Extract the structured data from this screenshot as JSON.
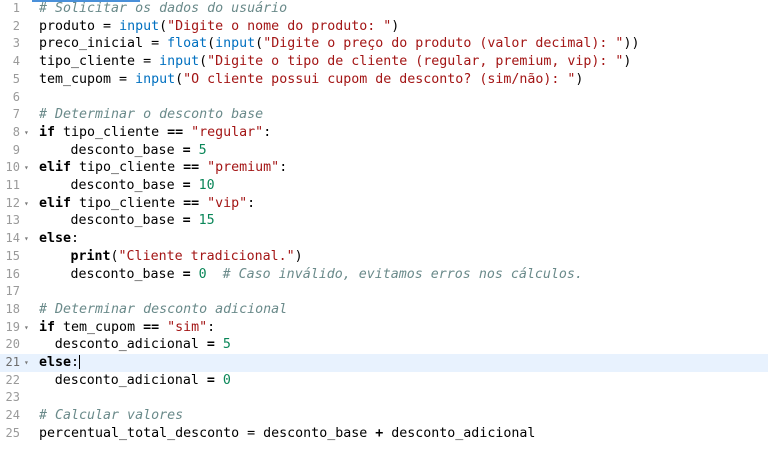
{
  "editor": {
    "active_line": 21,
    "lines": [
      {
        "n": "1",
        "fold": "",
        "indent": 0,
        "tokens": [
          {
            "t": "comment",
            "v": "# Solicitar os dados do usuário"
          }
        ]
      },
      {
        "n": "2",
        "fold": "",
        "indent": 0,
        "tokens": [
          {
            "t": "plain",
            "v": "produto = "
          },
          {
            "t": "fn",
            "v": "input"
          },
          {
            "t": "plain",
            "v": "("
          },
          {
            "t": "str",
            "v": "\"Digite o nome do produto: \""
          },
          {
            "t": "plain",
            "v": ")"
          }
        ]
      },
      {
        "n": "3",
        "fold": "",
        "indent": 0,
        "tokens": [
          {
            "t": "plain",
            "v": "preco_inicial = "
          },
          {
            "t": "fn",
            "v": "float"
          },
          {
            "t": "plain",
            "v": "("
          },
          {
            "t": "fn",
            "v": "input"
          },
          {
            "t": "plain",
            "v": "("
          },
          {
            "t": "str",
            "v": "\"Digite o preço do produto (valor decimal): \""
          },
          {
            "t": "plain",
            "v": "))"
          }
        ]
      },
      {
        "n": "4",
        "fold": "",
        "indent": 0,
        "tokens": [
          {
            "t": "plain",
            "v": "tipo_cliente = "
          },
          {
            "t": "fn",
            "v": "input"
          },
          {
            "t": "plain",
            "v": "("
          },
          {
            "t": "str",
            "v": "\"Digite o tipo de cliente (regular, premium, vip): \""
          },
          {
            "t": "plain",
            "v": ")"
          }
        ]
      },
      {
        "n": "5",
        "fold": "",
        "indent": 0,
        "tokens": [
          {
            "t": "plain",
            "v": "tem_cupom = "
          },
          {
            "t": "fn",
            "v": "input"
          },
          {
            "t": "plain",
            "v": "("
          },
          {
            "t": "str",
            "v": "\"O cliente possui cupom de desconto? (sim/não): \""
          },
          {
            "t": "plain",
            "v": ")"
          }
        ]
      },
      {
        "n": "6",
        "fold": "",
        "indent": 0,
        "tokens": []
      },
      {
        "n": "7",
        "fold": "",
        "indent": 0,
        "tokens": [
          {
            "t": "comment",
            "v": "# Determinar o desconto base"
          }
        ]
      },
      {
        "n": "8",
        "fold": "▾",
        "indent": 0,
        "tokens": [
          {
            "t": "kw",
            "v": "if"
          },
          {
            "t": "plain",
            "v": " tipo_cliente "
          },
          {
            "t": "kw",
            "v": "=="
          },
          {
            "t": "plain",
            "v": " "
          },
          {
            "t": "str",
            "v": "\"regular\""
          },
          {
            "t": "plain",
            "v": ":"
          }
        ]
      },
      {
        "n": "9",
        "fold": "",
        "indent": 1,
        "tokens": [
          {
            "t": "plain",
            "v": "desconto_base "
          },
          {
            "t": "kw",
            "v": "="
          },
          {
            "t": "plain",
            "v": " "
          },
          {
            "t": "num",
            "v": "5"
          }
        ]
      },
      {
        "n": "10",
        "fold": "▾",
        "indent": 0,
        "tokens": [
          {
            "t": "kw",
            "v": "elif"
          },
          {
            "t": "plain",
            "v": " tipo_cliente "
          },
          {
            "t": "kw",
            "v": "=="
          },
          {
            "t": "plain",
            "v": " "
          },
          {
            "t": "str",
            "v": "\"premium\""
          },
          {
            "t": "plain",
            "v": ":"
          }
        ]
      },
      {
        "n": "11",
        "fold": "",
        "indent": 1,
        "tokens": [
          {
            "t": "plain",
            "v": "desconto_base "
          },
          {
            "t": "kw",
            "v": "="
          },
          {
            "t": "plain",
            "v": " "
          },
          {
            "t": "num",
            "v": "10"
          }
        ]
      },
      {
        "n": "12",
        "fold": "▾",
        "indent": 0,
        "tokens": [
          {
            "t": "kw",
            "v": "elif"
          },
          {
            "t": "plain",
            "v": " tipo_cliente "
          },
          {
            "t": "kw",
            "v": "=="
          },
          {
            "t": "plain",
            "v": " "
          },
          {
            "t": "str",
            "v": "\"vip\""
          },
          {
            "t": "plain",
            "v": ":"
          }
        ]
      },
      {
        "n": "13",
        "fold": "",
        "indent": 1,
        "tokens": [
          {
            "t": "plain",
            "v": "desconto_base "
          },
          {
            "t": "kw",
            "v": "="
          },
          {
            "t": "plain",
            "v": " "
          },
          {
            "t": "num",
            "v": "15"
          }
        ]
      },
      {
        "n": "14",
        "fold": "▾",
        "indent": 0,
        "tokens": [
          {
            "t": "kw",
            "v": "else"
          },
          {
            "t": "plain",
            "v": ":"
          }
        ]
      },
      {
        "n": "15",
        "fold": "",
        "indent": 1,
        "tokens": [
          {
            "t": "kw",
            "v": "print"
          },
          {
            "t": "plain",
            "v": "("
          },
          {
            "t": "str",
            "v": "\"Cliente tradicional.\""
          },
          {
            "t": "plain",
            "v": ")"
          }
        ]
      },
      {
        "n": "16",
        "fold": "",
        "indent": 1,
        "tokens": [
          {
            "t": "plain",
            "v": "desconto_base "
          },
          {
            "t": "kw",
            "v": "="
          },
          {
            "t": "plain",
            "v": " "
          },
          {
            "t": "num",
            "v": "0"
          },
          {
            "t": "plain",
            "v": "  "
          },
          {
            "t": "comment",
            "v": "# Caso inválido, evitamos erros nos cálculos."
          }
        ]
      },
      {
        "n": "17",
        "fold": "",
        "indent": 0,
        "tokens": []
      },
      {
        "n": "18",
        "fold": "",
        "indent": 0,
        "tokens": [
          {
            "t": "comment",
            "v": "# Determinar desconto adicional"
          }
        ]
      },
      {
        "n": "19",
        "fold": "▾",
        "indent": 0,
        "tokens": [
          {
            "t": "kw",
            "v": "if"
          },
          {
            "t": "plain",
            "v": " tem_cupom "
          },
          {
            "t": "kw",
            "v": "=="
          },
          {
            "t": "plain",
            "v": " "
          },
          {
            "t": "str",
            "v": "\"sim\""
          },
          {
            "t": "plain",
            "v": ":"
          }
        ]
      },
      {
        "n": "20",
        "fold": "",
        "indent": 0.5,
        "tokens": [
          {
            "t": "plain",
            "v": "desconto_adicional "
          },
          {
            "t": "kw",
            "v": "="
          },
          {
            "t": "plain",
            "v": " "
          },
          {
            "t": "num",
            "v": "5"
          }
        ]
      },
      {
        "n": "21",
        "fold": "▾",
        "indent": 0,
        "tokens": [
          {
            "t": "kw",
            "v": "else"
          },
          {
            "t": "plain",
            "v": ":"
          }
        ],
        "cursor": true
      },
      {
        "n": "22",
        "fold": "",
        "indent": 0.5,
        "tokens": [
          {
            "t": "plain",
            "v": "desconto_adicional "
          },
          {
            "t": "kw",
            "v": "="
          },
          {
            "t": "plain",
            "v": " "
          },
          {
            "t": "num",
            "v": "0"
          }
        ]
      },
      {
        "n": "23",
        "fold": "",
        "indent": 0,
        "tokens": []
      },
      {
        "n": "24",
        "fold": "",
        "indent": 0,
        "tokens": [
          {
            "t": "comment",
            "v": "# Calcular valores"
          }
        ]
      },
      {
        "n": "25",
        "fold": "",
        "indent": 0,
        "tokens": [
          {
            "t": "plain",
            "v": "percentual_total_desconto = desconto_base "
          },
          {
            "t": "kw",
            "v": "+"
          },
          {
            "t": "plain",
            "v": " desconto_adicional"
          }
        ]
      }
    ]
  }
}
